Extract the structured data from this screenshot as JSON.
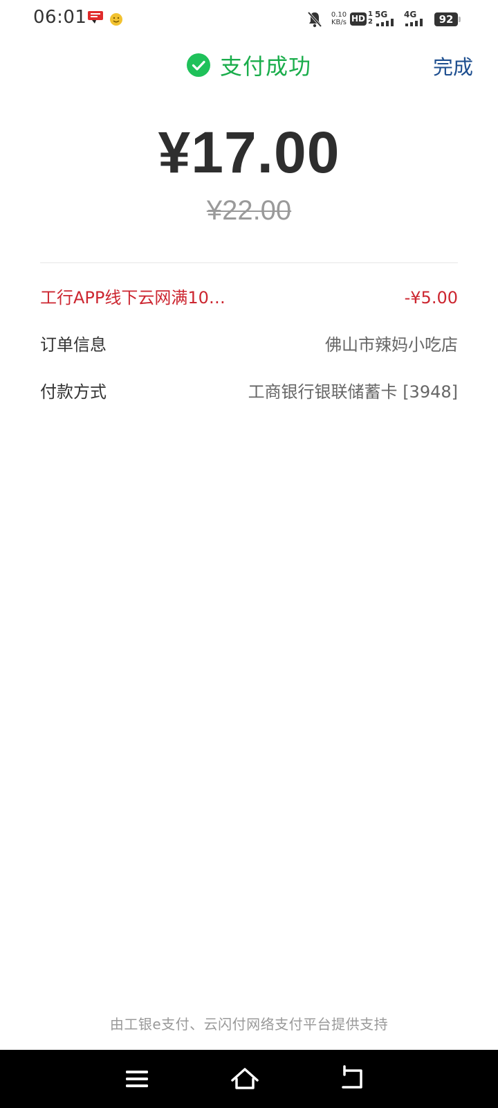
{
  "status_bar": {
    "time": "06:01",
    "net_speed_value": "0.10",
    "net_speed_unit": "KB/s",
    "hd_label": "HD",
    "network_5g": "5G",
    "network_4g": "4G",
    "battery": "92",
    "icons": [
      "notification-app-icon",
      "smiley-app-icon",
      "mute-bell-icon",
      "hd-voice-icon",
      "signal-5g-icon",
      "signal-4g-icon",
      "battery-icon"
    ]
  },
  "header": {
    "title": "支付成功",
    "done_label": "完成",
    "accent_color": "#1aad4b",
    "link_color": "#1d4e8f"
  },
  "payment": {
    "amount": "¥17.00",
    "original_amount": "¥22.00"
  },
  "details": {
    "discount_label": "工行APP线下云网满10…",
    "discount_value": "-¥5.00",
    "discount_color": "#cc2630",
    "order_label": "订单信息",
    "order_value": "佛山市辣妈小吃店",
    "payment_method_label": "付款方式",
    "payment_method_value": "工商银行银联储蓄卡 [3948]"
  },
  "footer": {
    "text": "由工银e支付、云闪付网络支付平台提供支持"
  },
  "nav_bar": {
    "icons": [
      "menu-icon",
      "home-icon",
      "back-icon"
    ]
  }
}
